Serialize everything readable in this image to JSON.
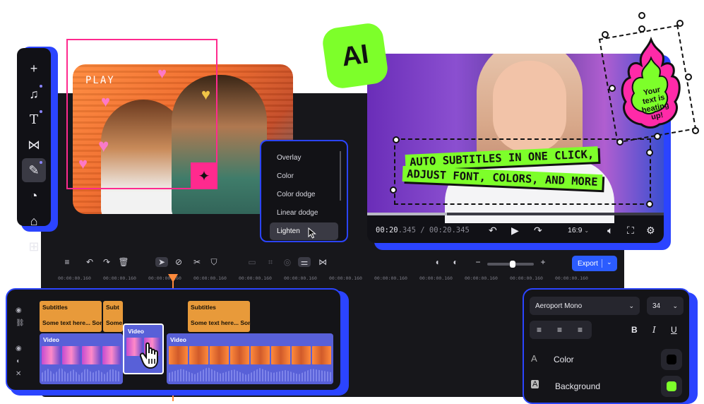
{
  "colors": {
    "accent_blue": "#2b44ff",
    "lime": "#7dff2a",
    "pink": "#ff2a8e",
    "orange": "#ff8a3c",
    "clip_orange": "#e89a3a",
    "clip_video": "#5860d8"
  },
  "toolbar": {
    "items": [
      {
        "name": "add-icon",
        "glyph": "+"
      },
      {
        "name": "music-icon",
        "glyph": "♫"
      },
      {
        "name": "text-icon",
        "glyph": "T"
      },
      {
        "name": "transitions-icon",
        "glyph": "⋈"
      },
      {
        "name": "effects-icon",
        "glyph": "✎"
      },
      {
        "name": "filters-icon",
        "glyph": "◔"
      },
      {
        "name": "stickers-icon",
        "glyph": "⌂"
      },
      {
        "name": "elements-icon",
        "glyph": "⊞"
      }
    ]
  },
  "photo": {
    "play_label": "PLAY"
  },
  "blend_menu": {
    "items": [
      "Overlay",
      "Color",
      "Color dodge",
      "Linear dodge",
      "Lighten"
    ],
    "selected": "Lighten"
  },
  "ai_badge": "AI",
  "preview": {
    "time_current": "00:20",
    "time_current_ms": ".345",
    "time_sep": " / ",
    "time_total": "00:20.345",
    "aspect": "16:9",
    "progress": 0.27
  },
  "subtitle": {
    "line1": "AUTO SUBTITLES IN ONE CLICK,",
    "line2": "ADJUST FONT, COLORS, AND MORE"
  },
  "sticker": {
    "line1": "Your",
    "line2": "text is",
    "line3": "heating",
    "line4": "up!"
  },
  "editor_toolbar": {
    "export_label": "Export"
  },
  "ruler": {
    "labels": [
      "00:00:00.160",
      "00:00:00.160",
      "00:00:00.160",
      "00:00:00.160",
      "00:00:00.160",
      "00:00:00.160",
      "00:00:00.160",
      "00:00:00.160",
      "00:00:00.160",
      "00:00:00.160",
      "00:00:00.160",
      "00:00:00.160"
    ]
  },
  "timeline": {
    "sub_clips": [
      {
        "title": "Subtitles",
        "text": "Some text here... Some"
      },
      {
        "title": "Subt",
        "text": "Some"
      },
      {
        "title": "Subtitles",
        "text": "Some text here... Some"
      }
    ],
    "video_clips": [
      {
        "title": "Video"
      },
      {
        "title": "Video"
      },
      {
        "title": "Video"
      }
    ]
  },
  "properties": {
    "font": "Aeroport Mono",
    "size": "34",
    "color_label": "Color",
    "color_value": "#000000",
    "background_label": "Background",
    "background_value": "#7dff2a"
  }
}
